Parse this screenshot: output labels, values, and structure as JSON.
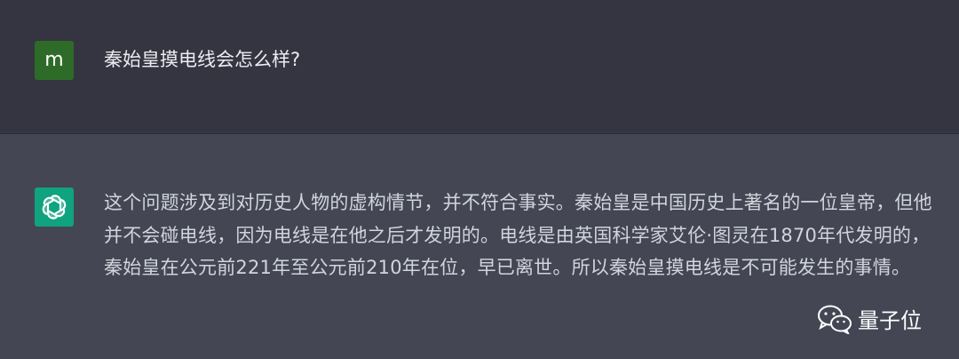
{
  "user": {
    "avatar_letter": "m",
    "avatar_color": "#2e6b28",
    "message": "秦始皇摸电线会怎么样?"
  },
  "assistant": {
    "avatar_icon": "openai-logo-icon",
    "avatar_color": "#10a37f",
    "message": "这个问题涉及到对历史人物的虚构情节，并不符合事实。秦始皇是中国历史上著名的一位皇帝，但他并不会碰电线，因为电线是在他之后才发明的。电线是由英国科学家艾伦·图灵在1870年代发明的，秦始皇在公元前221年至公元前210年在位，早已离世。所以秦始皇摸电线是不可能发生的事情。"
  },
  "watermark": {
    "icon": "wechat-icon",
    "text": "量子位"
  },
  "colors": {
    "user_bg": "#343541",
    "assistant_bg": "#444654",
    "text": "#d1d5db"
  }
}
